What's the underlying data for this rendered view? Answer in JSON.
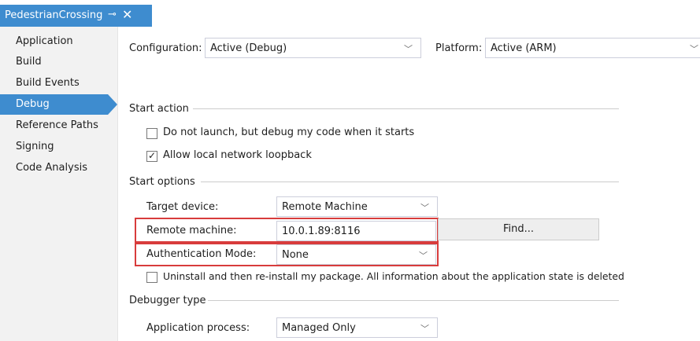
{
  "tab": {
    "title": "PedestrianCrossing",
    "pin_icon": "pin-icon",
    "close_icon": "close-icon"
  },
  "sidebar": {
    "items": [
      {
        "label": "Application"
      },
      {
        "label": "Build"
      },
      {
        "label": "Build Events"
      },
      {
        "label": "Debug",
        "active": true
      },
      {
        "label": "Reference Paths"
      },
      {
        "label": "Signing"
      },
      {
        "label": "Code Analysis"
      }
    ]
  },
  "config": {
    "configuration_label": "Configuration:",
    "configuration_value": "Active (Debug)",
    "platform_label": "Platform:",
    "platform_value": "Active (ARM)"
  },
  "start_action": {
    "heading": "Start action",
    "do_not_launch": {
      "label": "Do not launch, but debug my code when it starts",
      "checked": false
    },
    "allow_loopback": {
      "label": "Allow local network loopback",
      "checked": true
    }
  },
  "start_options": {
    "heading": "Start options",
    "target_device_label": "Target device:",
    "target_device_value": "Remote Machine",
    "remote_machine_label": "Remote machine:",
    "remote_machine_value": "10.0.1.89:8116",
    "find_button": "Find...",
    "auth_mode_label": "Authentication Mode:",
    "auth_mode_value": "None",
    "uninstall": {
      "label": "Uninstall and then re-install my package. All information about the application state is deleted",
      "checked": false
    }
  },
  "debugger_type": {
    "heading": "Debugger type",
    "app_process_label": "Application process:",
    "app_process_value": "Managed Only"
  },
  "colors": {
    "accent": "#3e8ccf",
    "highlight": "#d83c3c"
  }
}
